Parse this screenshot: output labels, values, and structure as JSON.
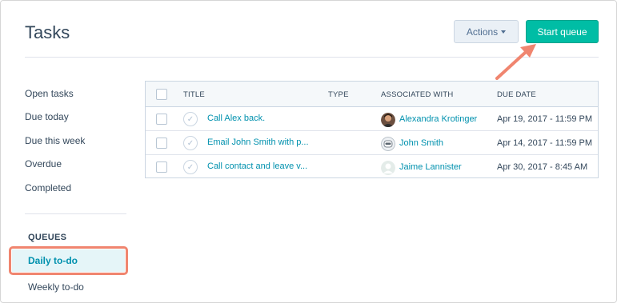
{
  "page": {
    "title": "Tasks"
  },
  "toolbar": {
    "actions_label": "Actions",
    "start_queue_label": "Start queue"
  },
  "sidebar": {
    "items": [
      {
        "label": "Open tasks"
      },
      {
        "label": "Due today"
      },
      {
        "label": "Due this week"
      },
      {
        "label": "Overdue"
      },
      {
        "label": "Completed"
      }
    ],
    "queues_heading": "QUEUES",
    "queues": [
      {
        "label": "Daily to-do",
        "selected": true
      },
      {
        "label": "Weekly to-do",
        "selected": false
      }
    ]
  },
  "table": {
    "headers": {
      "title": "TITLE",
      "type": "TYPE",
      "associated": "ASSOCIATED WITH",
      "due": "DUE DATE"
    },
    "rows": [
      {
        "title": "Call Alex back.",
        "type": "",
        "associated": "Alexandra Krotinger",
        "avatar": "photo-avatar",
        "due": "Apr 19, 2017 - 11:59 PM"
      },
      {
        "title": "Email John Smith with p...",
        "type": "",
        "associated": "John Smith",
        "avatar": "robot-avatar",
        "due": "Apr 14, 2017 - 11:59 PM"
      },
      {
        "title": "Call contact and leave v...",
        "type": "",
        "associated": "Jaime Lannister",
        "avatar": "default-person-avatar",
        "due": "Apr 30, 2017 - 8:45 AM"
      }
    ]
  },
  "colors": {
    "primary": "#00bda5",
    "link": "#0091ae",
    "highlight": "#f0856f",
    "text": "#33475b"
  },
  "icons": {
    "row_status": "checkmark-circle-icon",
    "dropdown": "caret-down-icon",
    "annotation": "arrow-pointer-icon"
  }
}
